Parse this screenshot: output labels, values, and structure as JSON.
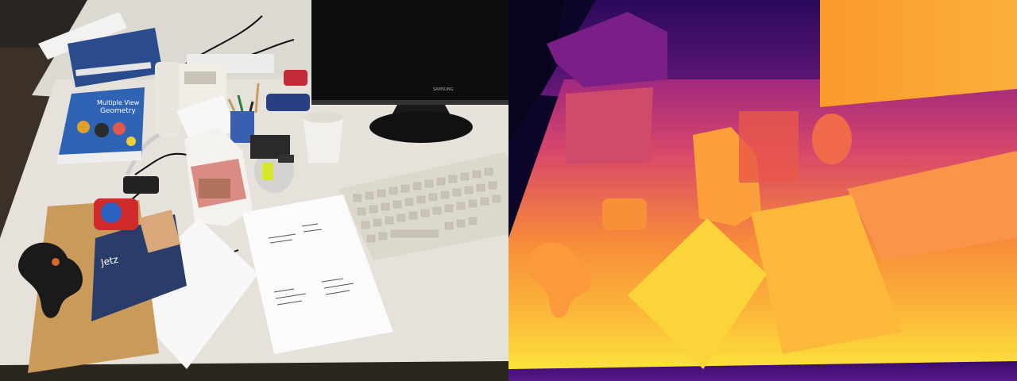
{
  "panels": {
    "rgb": {
      "kind": "photo"
    },
    "depth": {
      "kind": "depth-map"
    }
  },
  "scene": {
    "book_top": {
      "title": "Multiple View",
      "title2": "Geometry"
    },
    "book_back": {
      "text": "Jetz"
    },
    "monitor": {
      "brand": "SAMSUNG"
    }
  },
  "colors": {
    "desk": "#e6e2db",
    "floor": "#3a3128",
    "depth_far": "#0d0628",
    "depth_mid": "#c0387a",
    "depth_near": "#fbe63a"
  }
}
